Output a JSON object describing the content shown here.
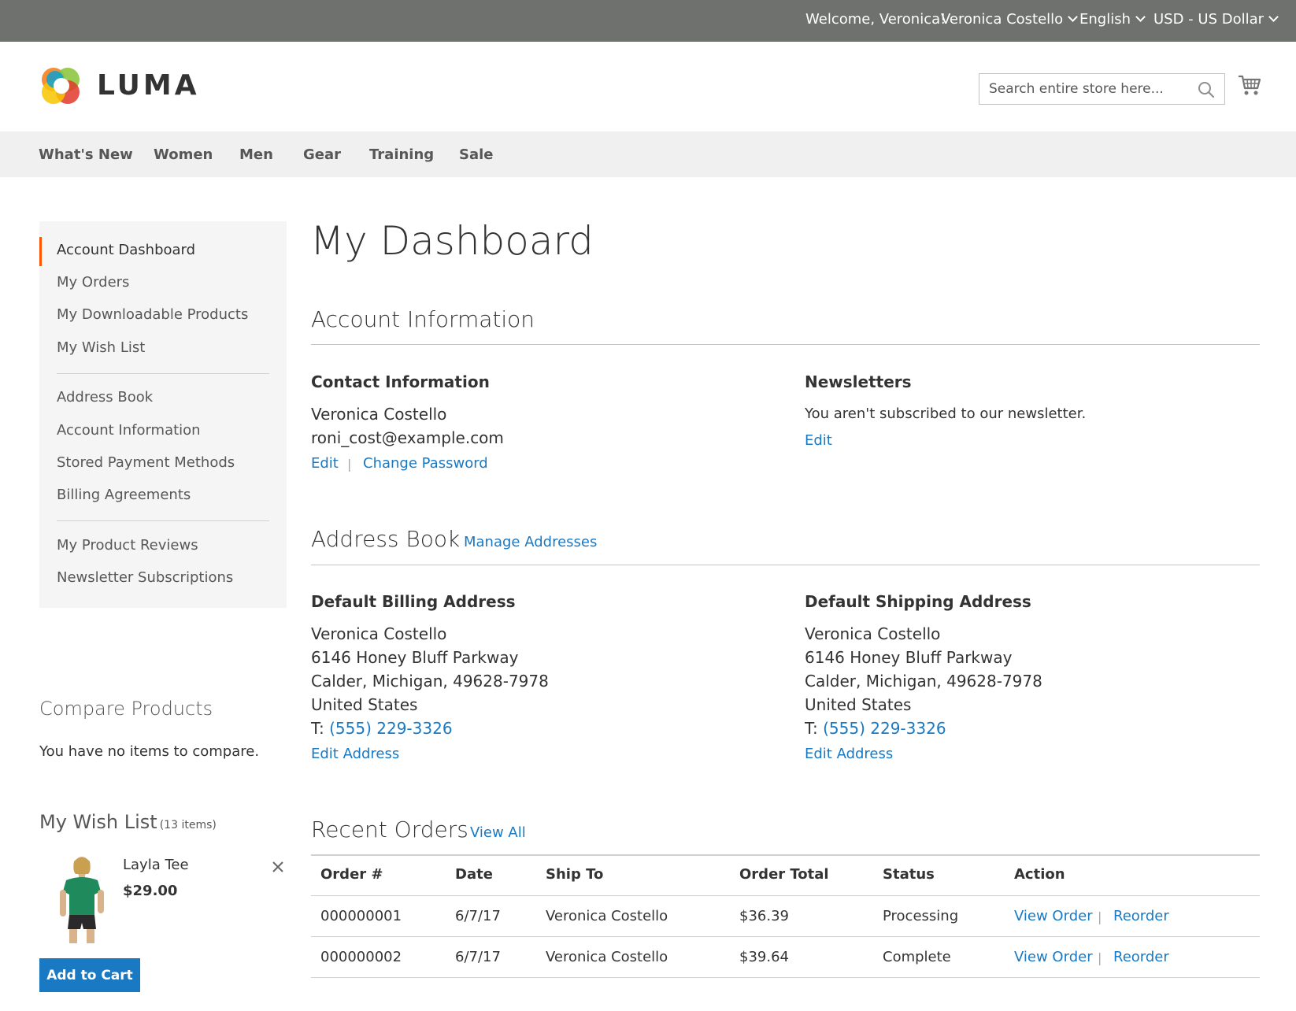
{
  "topbar": {
    "welcome": "Welcome, Veronica!",
    "account": "Veronica Costello",
    "language": "English",
    "currency": "USD - US Dollar"
  },
  "header": {
    "logo_text": "LUMA",
    "search_placeholder": "Search entire store here...",
    "cart_icon": "cart-icon",
    "search_icon": "search-icon"
  },
  "nav": {
    "items": [
      "What's New",
      "Women",
      "Men",
      "Gear",
      "Training",
      "Sale"
    ]
  },
  "sidebar": {
    "group1": [
      "Account Dashboard",
      "My Orders",
      "My Downloadable Products",
      "My Wish List"
    ],
    "group2": [
      "Address Book",
      "Account Information",
      "Stored Payment Methods",
      "Billing Agreements"
    ],
    "group3": [
      "My Product Reviews",
      "Newsletter Subscriptions"
    ],
    "active_color": "#ff5501"
  },
  "compare": {
    "title": "Compare Products",
    "empty_text": "You have no items to compare."
  },
  "wishlist": {
    "title": "My Wish List",
    "count": "(13 items)",
    "item_name": "Layla Tee",
    "item_price": "$29.00",
    "add_to_cart": "Add to Cart"
  },
  "main": {
    "page_title": "My Dashboard",
    "account_info": {
      "title": "Account Information",
      "contact_title": "Contact Information",
      "name": "Veronica Costello",
      "email": "roni_cost@example.com",
      "edit": "Edit",
      "separator": "|",
      "change_password": "Change Password",
      "newsletters_title": "Newsletters",
      "newsletters_text": "You aren't subscribed to our newsletter.",
      "newsletters_edit": "Edit"
    },
    "address_book": {
      "title": "Address Book",
      "manage": "Manage Addresses",
      "billing": {
        "title": "Default Billing Address",
        "name": "Veronica Costello",
        "street": "6146 Honey Bluff Parkway",
        "city": "Calder, Michigan, 49628-7978",
        "country": "United States",
        "phone_label": "T:",
        "phone": "(555) 229-3326",
        "edit": "Edit Address"
      },
      "shipping": {
        "title": "Default Shipping Address",
        "name": "Veronica Costello",
        "street": "6146 Honey Bluff Parkway",
        "city": "Calder, Michigan, 49628-7978",
        "country": "United States",
        "phone_label": "T:",
        "phone": "(555) 229-3326",
        "edit": "Edit Address"
      }
    },
    "recent_orders": {
      "title": "Recent Orders",
      "view_all": "View All",
      "columns": [
        "Order #",
        "Date",
        "Ship To",
        "Order Total",
        "Status",
        "Action"
      ],
      "rows": [
        {
          "order": "000000001",
          "date": "6/7/17",
          "ship_to": "Veronica Costello",
          "total": "$36.39",
          "status": "Processing",
          "view": "View Order",
          "reorder": "Reorder"
        },
        {
          "order": "000000002",
          "date": "6/7/17",
          "ship_to": "Veronica Costello",
          "total": "$39.64",
          "status": "Complete",
          "view": "View Order",
          "reorder": "Reorder"
        }
      ],
      "action_separator": "|"
    }
  },
  "colors": {
    "topbar_bg": "#6e716e",
    "nav_bg": "#f0f0f0",
    "link": "#1979c3",
    "primary_button": "#1979c3"
  }
}
